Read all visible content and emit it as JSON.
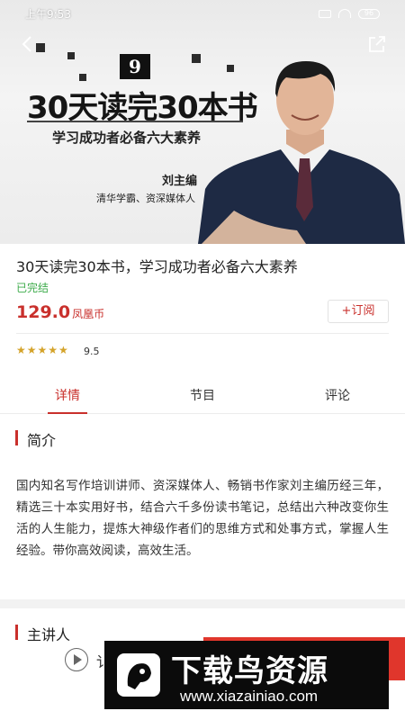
{
  "status_bar": {
    "time": "上午9:53",
    "battery": "96"
  },
  "banner": {
    "logo_char": "9",
    "book_title": "30天读完30本书",
    "subtitle": "学习成功者必备六大素养",
    "author_name": "刘主编",
    "author_desc": "清华学霸、资深媒体人"
  },
  "info": {
    "title": "30天读完30本书，学习成功者必备六大素养",
    "status": "已完结",
    "price": "129.0",
    "price_unit": "凤凰币",
    "subscribe_label": "+订阅",
    "stars": "★★★★★",
    "rating": "9.5",
    "rating_value": 4.75
  },
  "tabs": [
    {
      "label": "详情",
      "active": true
    },
    {
      "label": "节目",
      "active": false
    },
    {
      "label": "评论",
      "active": false
    }
  ],
  "intro": {
    "heading": "简介",
    "text": "国内知名写作培训讲师、资深媒体人、畅销书作家刘主编历经三年，精选三十本实用好书，结合六千多份读书笔记，总结出六种改变你生活的人生能力，提炼大神级作者们的思维方式和处事方式，掌握人生经验。带你高效阅读，高效生活。"
  },
  "lecturer": {
    "heading": "主讲人",
    "fragment": "讠"
  },
  "watermark": {
    "cn": "下载鸟资源",
    "url": "www.xiazainiao.com"
  },
  "colors": {
    "accent": "#c9302c",
    "done": "#3cab4a",
    "star": "#d4a32a"
  },
  "icons": [
    "back-icon",
    "share-icon",
    "play-icon",
    "wifi-icon",
    "battery-icon",
    "sim-icon"
  ]
}
